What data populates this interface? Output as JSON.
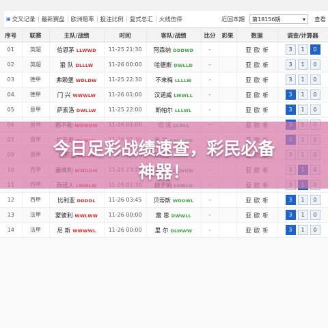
{
  "toolbar": {
    "items": [
      "交叉记录",
      "最新赛盘",
      "欧洲赔率",
      "投注比例",
      "复式总汇",
      "火线伤停"
    ],
    "period_label": "近回本期",
    "period_value": "第18156期",
    "view_label": "查看"
  },
  "table": {
    "headers": [
      "序号",
      "联赛",
      "主队/战绩",
      "时间",
      "客队/战绩",
      "比分",
      "彩果",
      "数据",
      "调查/计算器"
    ],
    "rows": [
      {
        "no": "01",
        "league": "英超",
        "home": "伯恩茅",
        "home_rec": "LLWWD",
        "time": "11-25 21:30",
        "away": "阿森纳",
        "away_rec": "DDDWD",
        "score": "-",
        "result": "",
        "data": [
          "亚",
          "欧",
          "析"
        ],
        "calc": [
          "3",
          "1",
          "0"
        ],
        "hl": 2
      },
      {
        "no": "02",
        "league": "英超",
        "home": "狼 队",
        "home_rec": "DLLLW",
        "time": "11-26 00:00",
        "away": "哈德斯",
        "away_rec": "DWLLD",
        "score": "-",
        "result": "",
        "data": [
          "亚",
          "欧",
          "析"
        ],
        "calc": [
          "3",
          "1",
          "0"
        ],
        "hl": -1
      },
      {
        "no": "03",
        "league": "德甲",
        "home": "弗赖堡",
        "home_rec": "WDLDW",
        "time": "11-25 22:30",
        "away": "不来梅",
        "away_rec": "LLLLW",
        "score": "-",
        "result": "",
        "data": [
          "亚",
          "欧",
          "析"
        ],
        "calc": [
          "3",
          "1",
          "0"
        ],
        "hl": -1
      },
      {
        "no": "04",
        "league": "德甲",
        "home": "门 兴",
        "home_rec": "WWWLW",
        "time": "11-26 01:00",
        "away": "汉诺威",
        "away_rec": "LWWLL",
        "score": "-",
        "result": "",
        "data": [
          "亚",
          "欧",
          "析"
        ],
        "calc": [
          "3",
          "1",
          "0"
        ],
        "hl": 0
      },
      {
        "no": "05",
        "league": "意甲",
        "home": "萨索洛",
        "home_rec": "DWLLW",
        "time": "11-25 22:00",
        "away": "斯帕尔",
        "away_rec": "LLLWL",
        "score": "-",
        "result": "",
        "data": [
          "亚",
          "欧",
          "析"
        ],
        "calc": [
          "3",
          "1",
          "0"
        ],
        "hl": 0
      },
      {
        "no": "06",
        "league": "意甲",
        "home": "那不勒",
        "home_rec": "WDWDW",
        "time": "11-26 01:00",
        "away": "切 沃",
        "away_rec": "LLDLL",
        "score": "-",
        "result": "",
        "data": [
          "亚",
          "欧",
          "析"
        ],
        "calc": [
          "3",
          "1",
          "0"
        ],
        "hl": 0
      },
      {
        "no": "07",
        "league": "意甲",
        "home": "拉齐奥",
        "home_rec": "WLWWL",
        "time": "11-26 03:30",
        "away": "米 兰",
        "away_rec": "DWWWD",
        "score": "-",
        "result": "",
        "data": [
          "亚",
          "欧",
          "析"
        ],
        "calc": [
          "3",
          "1",
          "0"
        ],
        "hl": 0
      },
      {
        "no": "09",
        "league": "意甲",
        "home": "热那亚",
        "home_rec": "LLLDD",
        "time": "11-26 03:30",
        "away": "桑普多",
        "away_rec": "LLDWW",
        "score": "-",
        "result": "",
        "data": [
          "亚",
          "欧",
          "析"
        ],
        "calc": [
          "3",
          "1",
          "0"
        ],
        "hl": -1
      },
      {
        "no": "10",
        "league": "西甲",
        "home": "塞维利",
        "home_rec": "WWDDW",
        "time": "11-25 23:15",
        "away": "巴利亚",
        "away_rec": "DLWDW",
        "score": "-",
        "result": "",
        "data": [
          "亚",
          "欧",
          "析"
        ],
        "calc": [
          "3",
          "1",
          "0"
        ],
        "hl": 1
      },
      {
        "no": "11",
        "league": "西甲",
        "home": "西班人",
        "home_rec": "LWWLW",
        "time": "11-26 01:30",
        "away": "赫罗纳",
        "away_rec": "LDWLD",
        "score": "-",
        "result": "",
        "data": [
          "亚",
          "欧",
          "析"
        ],
        "calc": [
          "3",
          "1",
          "0"
        ],
        "hl": 1
      },
      {
        "no": "12",
        "league": "西甲",
        "home": "比利亚",
        "home_rec": "DDDDL",
        "time": "11-26 03:45",
        "away": "贝蒂斯",
        "away_rec": "WDDWL",
        "score": "-",
        "result": "",
        "data": [
          "亚",
          "欧",
          "析"
        ],
        "calc": [
          "3",
          "1",
          "0"
        ],
        "hl": 0
      },
      {
        "no": "13",
        "league": "法甲",
        "home": "蒙彼利",
        "home_rec": "WWLWW",
        "time": "11-26 00:00",
        "away": "雷 恩",
        "away_rec": "DWWLL",
        "score": "-",
        "result": "",
        "data": [
          "亚",
          "欧",
          "析"
        ],
        "calc": [
          "3",
          "1",
          "0"
        ],
        "hl": 0
      },
      {
        "no": "14",
        "league": "法甲",
        "home": "尼 斯",
        "home_rec": "WWWWL",
        "time": "11-26 00:00",
        "away": "里 尔",
        "away_rec": "DLWWW",
        "score": "-",
        "result": "",
        "data": [
          "亚",
          "欧",
          "析"
        ],
        "calc": [
          "3",
          "1",
          "0"
        ],
        "hl": 0
      }
    ]
  },
  "banner": {
    "line1": "今日足彩战绩速查，彩民必备",
    "line2": "神器！"
  }
}
